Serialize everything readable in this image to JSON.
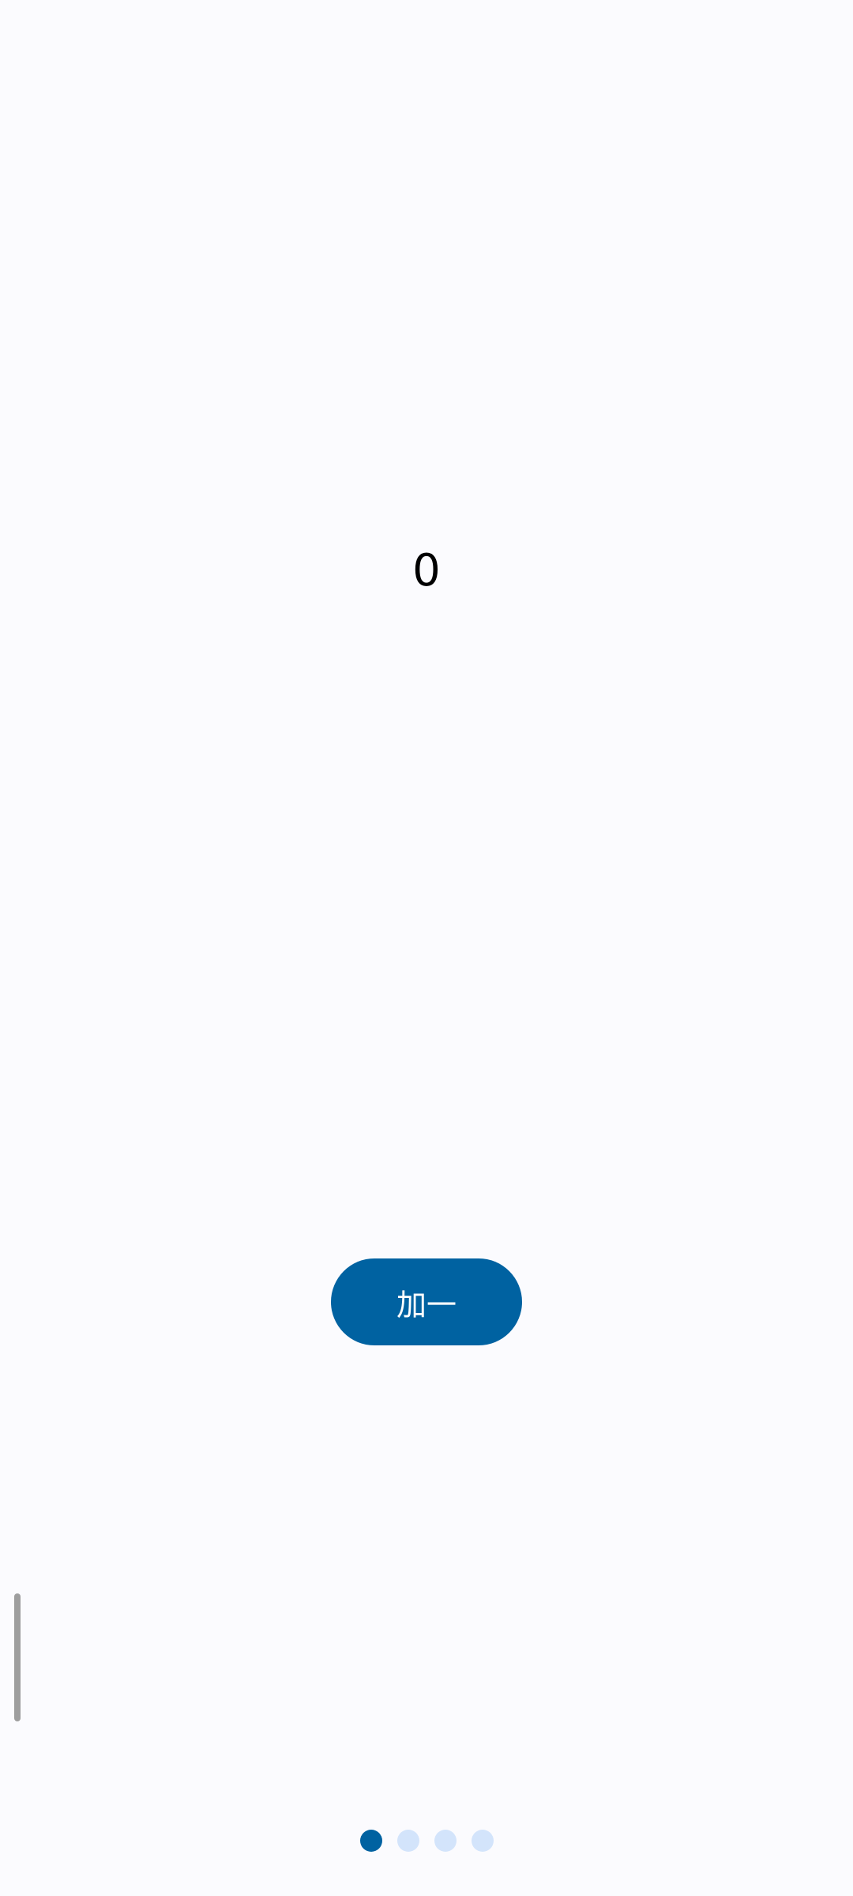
{
  "counter": {
    "value": "0"
  },
  "increment_button": {
    "label": "加一"
  },
  "page_indicator": {
    "total_pages": 4,
    "active_index": 0
  },
  "colors": {
    "background": "#fbfbfe",
    "accent": "#0062a1",
    "dot_inactive": "#d3e4fb",
    "scrollbar": "#9e9e9e"
  }
}
